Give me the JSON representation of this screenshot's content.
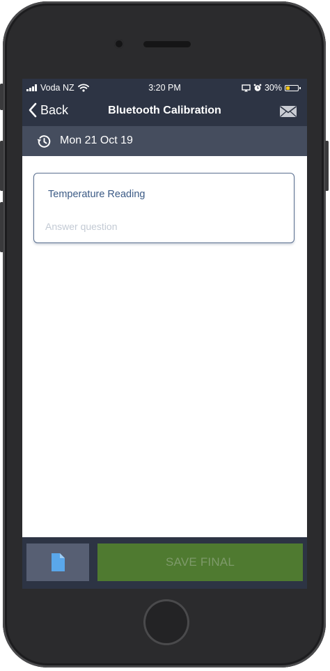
{
  "status_bar": {
    "carrier": "Voda NZ",
    "time": "3:20 PM",
    "battery_percent": "30%",
    "battery_level": 0.3
  },
  "nav": {
    "back_label": "Back",
    "title": "Bluetooth Calibration"
  },
  "date_bar": {
    "date": "Mon 21 Oct 19"
  },
  "question": {
    "label": "Temperature Reading",
    "value": "",
    "placeholder": "Answer question"
  },
  "bottom_bar": {
    "save_label": "SAVE FINAL"
  },
  "colors": {
    "header_bg": "#2d3444",
    "date_bar_bg": "#454d5e",
    "save_bg": "#4f7a30",
    "doc_icon": "#5aa7ea",
    "battery": "#f5c518"
  }
}
